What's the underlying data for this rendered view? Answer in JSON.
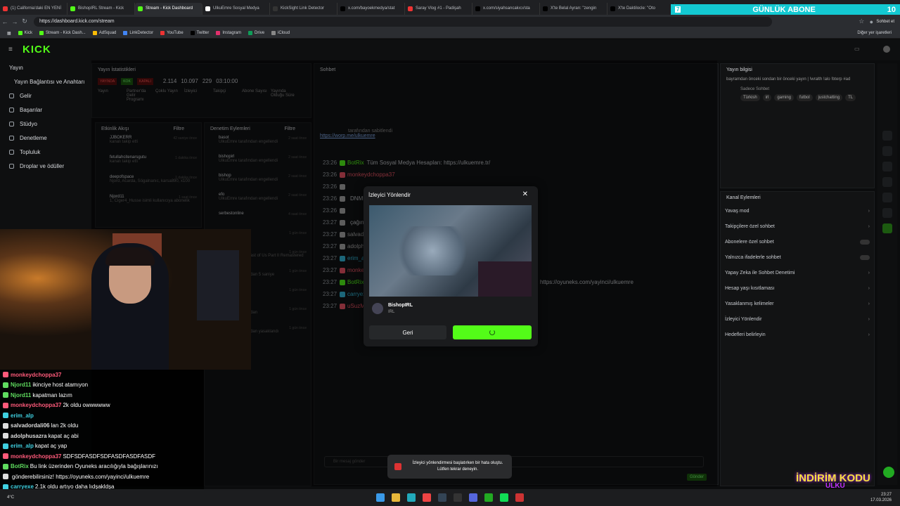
{
  "browser": {
    "tabs": [
      {
        "label": "(1) California'daki EN YENİ",
        "color": "#e33"
      },
      {
        "label": "BishopIRL Stream - Kick",
        "color": "#53fc18"
      },
      {
        "label": "Stream - Kick Dashboard",
        "color": "#53fc18",
        "active": true
      },
      {
        "label": "UlkuEmre Sosyal Medya",
        "color": "#fff"
      },
      {
        "label": "KickSight Link Detector",
        "color": "#333"
      },
      {
        "label": "x.com/bayoekmedya/stat",
        "color": "#000"
      },
      {
        "label": "Saray Vlog #1 - Padişah",
        "color": "#e33"
      },
      {
        "label": "x.com/siyahsancakıcı/sta",
        "color": "#000"
      },
      {
        "label": "X'te Belal Ayran: \"zengin",
        "color": "#000"
      },
      {
        "label": "X'te Daktilocle: \"Oto",
        "color": "#000"
      }
    ],
    "url": "https://dashboard.kick.com/stream",
    "chat_button": "Sohbet et",
    "bookmarks": [
      "Kick",
      "Stream - Kick Dash...",
      "AdSquad",
      "LinkDetector",
      "YouTube",
      "Twitter",
      "Instagram",
      "Drive",
      "iCloud"
    ],
    "other_bookmarks": "Diğer yer işaretleri"
  },
  "abone": {
    "label": "GÜNLÜK ABONE",
    "count": "10",
    "n": "7"
  },
  "nav": {
    "logo": "KICK",
    "items": [
      {
        "label": "Yayın"
      },
      {
        "label": "Yayın Bağlantısı ve Anahtarı"
      },
      {
        "label": "Gelir"
      },
      {
        "label": "Başarılar"
      },
      {
        "label": "Stüdyo"
      },
      {
        "label": "Denetleme"
      },
      {
        "label": "Topluluk"
      },
      {
        "label": "Droplar ve ödüller"
      }
    ]
  },
  "stats": {
    "title": "Yayın İstatistikleri",
    "status": [
      "YAYINDA",
      "KOK",
      "KAPALI"
    ],
    "values": [
      "2.114",
      "10.097",
      "229",
      "03:10:00"
    ],
    "labels": [
      "İzleyici",
      "Takipçi",
      "Abone Sayısı",
      "Yayında Olduğu Süre"
    ],
    "cols": [
      "Yayın",
      "Partner'da Gelir Programı",
      "Çoklu Yayın"
    ]
  },
  "activity": {
    "title": "Etkinlik Akışı",
    "filter": "Filtre",
    "rows": [
      {
        "name": "JJBOKERR",
        "desc": "kanalı takip etti",
        "time": "42 saniye önce"
      },
      {
        "name": "fetullahcitenarsgutu",
        "desc": "kanalı takip etti",
        "time": "1 dakika önce"
      },
      {
        "name": "deepofspace",
        "desc": "Njord, Acarda, Sögalnanıc, karsa890, x100",
        "time": "1 dakika önce"
      },
      {
        "name": "Njord11",
        "desc": "1, Ciger4_Husse isimli kullanıcıya abonelik",
        "time": "1 saat önce"
      }
    ]
  },
  "mod": {
    "title": "Denetim Eylemleri",
    "filter": "Filtre",
    "rows": [
      {
        "name": "basot",
        "desc": "UlkuEmre tarafından engellendi",
        "time": "2 saat önce"
      },
      {
        "name": "bishopirl",
        "desc": "UlkuEmre tarafından engellendi",
        "time": "2 saat önce"
      },
      {
        "name": "bishop",
        "desc": "UlkuEmre tarafından engellendi",
        "time": "2 saat önce"
      },
      {
        "name": "efo",
        "desc": "UlkuEmre tarafından engellendi",
        "time": "2 saat önce"
      },
      {
        "name": "serbestonline",
        "desc": "",
        "time": "4 saat önce"
      },
      {
        "name": "44Baltal_Bati",
        "desc": "kanalı takip etti",
        "time": "1 gün önce"
      },
      {
        "name": "Kategori",
        "desc": "UlkuEmre: The Last of Us Part II Remastered",
        "time": "1 gün önce"
      },
      {
        "name": "alpish_42",
        "desc": "UlkuEmre tarafından 5 saniye",
        "time": "1 gün önce"
      },
      {
        "name": "UlkuEmre",
        "desc": "",
        "time": "1 gün önce"
      },
      {
        "name": "CosmicNovaNyx",
        "desc": "UlkuEmre tarafından",
        "time": "1 gün önce"
      },
      {
        "name": "CosmicNovaNyx",
        "desc": "UlkuEmre tarafından yasaklandı",
        "time": "1 gün önce"
      }
    ]
  },
  "chat": {
    "title": "Sohbet",
    "users": [
      "Njord11",
      "deepofspace",
      "monkeydchoppa37"
    ],
    "pinned_by": "tarafından sabitlendi",
    "pinned_link": "https://worp.me/ulkuemre",
    "lines": [
      {
        "ts": "23:26",
        "user": "BotRix",
        "msg": "Tüm Sosyal Medya Hesapları: https://ulkuemre.tr/",
        "color": "#53fc18"
      },
      {
        "ts": "23:26",
        "user": "monkeydchoppa37",
        "msg": "",
        "color": "#e56"
      },
      {
        "ts": "23:26",
        "user": "",
        "msg": "",
        "color": "#aaa"
      },
      {
        "ts": "23:26",
        "user": "",
        "msg": "DNMDMDNDMDNDMDM",
        "color": "#aaa"
      },
      {
        "ts": "23:26",
        "user": "",
        "msg": "",
        "color": "#aaa"
      },
      {
        "ts": "23:27",
        "user": "",
        "msg": "çağınız alışverişlerde \"ULKU\" kodunu kullanarak %3 indirimden",
        "color": "#aaa"
      },
      {
        "ts": "23:27",
        "user": "salvadordali06",
        "msg": "lan 2k oldu",
        "color": "#aaa"
      },
      {
        "ts": "23:27",
        "user": "adolphusazra",
        "msg": "kapat aç abi",
        "color": "#aaa"
      },
      {
        "ts": "23:27",
        "user": "erim_alp",
        "msg": "kapat aç yap",
        "color": "#3bd"
      },
      {
        "ts": "23:27",
        "user": "monkeydchoppa37",
        "msg": "SDFSDFASDFSDFASDFASDF",
        "color": "#e56"
      },
      {
        "ts": "23:27",
        "user": "BotRix",
        "msg": "Bu link üzerinden Oyuneks aracılığıyla bağışlarınızı gönderebilirsiniz! https://oyuneks.com/yayinci/ulkuemre",
        "color": "#53fc18"
      },
      {
        "ts": "23:27",
        "user": "carryexe",
        "msg": "2.1k oldu artıyo daha lıdşakldşa",
        "color": "#3bd"
      },
      {
        "ts": "23:27",
        "user": "uSuzMagic",
        "msg": "2.1k",
        "color": "#e56"
      }
    ],
    "input_placeholder": "Bir mesaj gönder",
    "send": "Gönder",
    "count": "0"
  },
  "info": {
    "title": "Yayın bilgisi",
    "desc": "bayramdan önceki sondan bir önceki yayın | !wralth !alo !bterp #ad",
    "cat": "Sadece Sohbet",
    "tags": [
      "Türkish",
      "irl",
      "gaming",
      "futbol",
      "justchatting",
      "TL"
    ]
  },
  "channel": {
    "title": "Kanal Eylemleri",
    "rows": [
      "Yavaş mod",
      "Takipçilere özel sohbet",
      "Abonelere özel sohbet",
      "Yalnızca ifadelerle sohbet",
      "Yapay Zeka ile Sohbet Denetimi",
      "Hesap yaşı kısıtlaması",
      "Yasaklanmış kelimeler",
      "İzleyici Yönlendir",
      "Hedefleri belirleyin"
    ]
  },
  "modal": {
    "title": "İzleyici Yönlendir",
    "channel": "BishopIRL",
    "category": "IRL",
    "back": "Geri"
  },
  "toast": {
    "msg": "İzleyici yönlendirmesi başlatırken bir hata oluştu. Lütfen tekrar deneyin."
  },
  "overlay_chat": [
    {
      "user": "monkeydchoppa37",
      "msg": "",
      "color": "#ff5a7a"
    },
    {
      "user": "Njord11",
      "msg": "ikinciye host atamıyon",
      "color": "#5fdc5f"
    },
    {
      "user": "Njord11",
      "msg": "kapatman lazım",
      "color": "#5fdc5f"
    },
    {
      "user": "monkeydchoppa37",
      "msg": "2k oldu owwwwww",
      "color": "#ff5a7a"
    },
    {
      "user": "erim_alp",
      "msg": "",
      "color": "#3fd0e0"
    },
    {
      "user": "salvadordali06",
      "msg": "lan 2k oldu",
      "color": "#ddd"
    },
    {
      "user": "adolphusazra",
      "msg": "kapat aç abi",
      "color": "#ddd"
    },
    {
      "user": "erim_alp",
      "msg": "kapat aç yap",
      "color": "#3fd0e0"
    },
    {
      "user": "monkeydchoppa37",
      "msg": "SDFSDFASDFSDFASDFASDFASDF",
      "color": "#ff5a7a"
    },
    {
      "user": "BotRix",
      "msg": "Bu link üzerinden Oyuneks aracılığıyla bağışlarınızı",
      "color": "#5fdc5f"
    },
    {
      "user": "",
      "msg": "gönderebilirsiniz! https://oyuneks.com/yayinci/ulkuemre",
      "color": "#ddd"
    },
    {
      "user": "carryexe",
      "msg": "2.1k oldu artıyo daha lıdşakldşa",
      "color": "#3fd0e0"
    },
    {
      "user": "uSuzMagic",
      "msg": "2.1k",
      "color": "#ff5a7a"
    }
  ],
  "promo": {
    "text": "İNDİRİM KODU",
    "code": "ULKU"
  },
  "taskbar": {
    "time": "23:27",
    "date": "17.03.2026",
    "weather": "4°C"
  }
}
